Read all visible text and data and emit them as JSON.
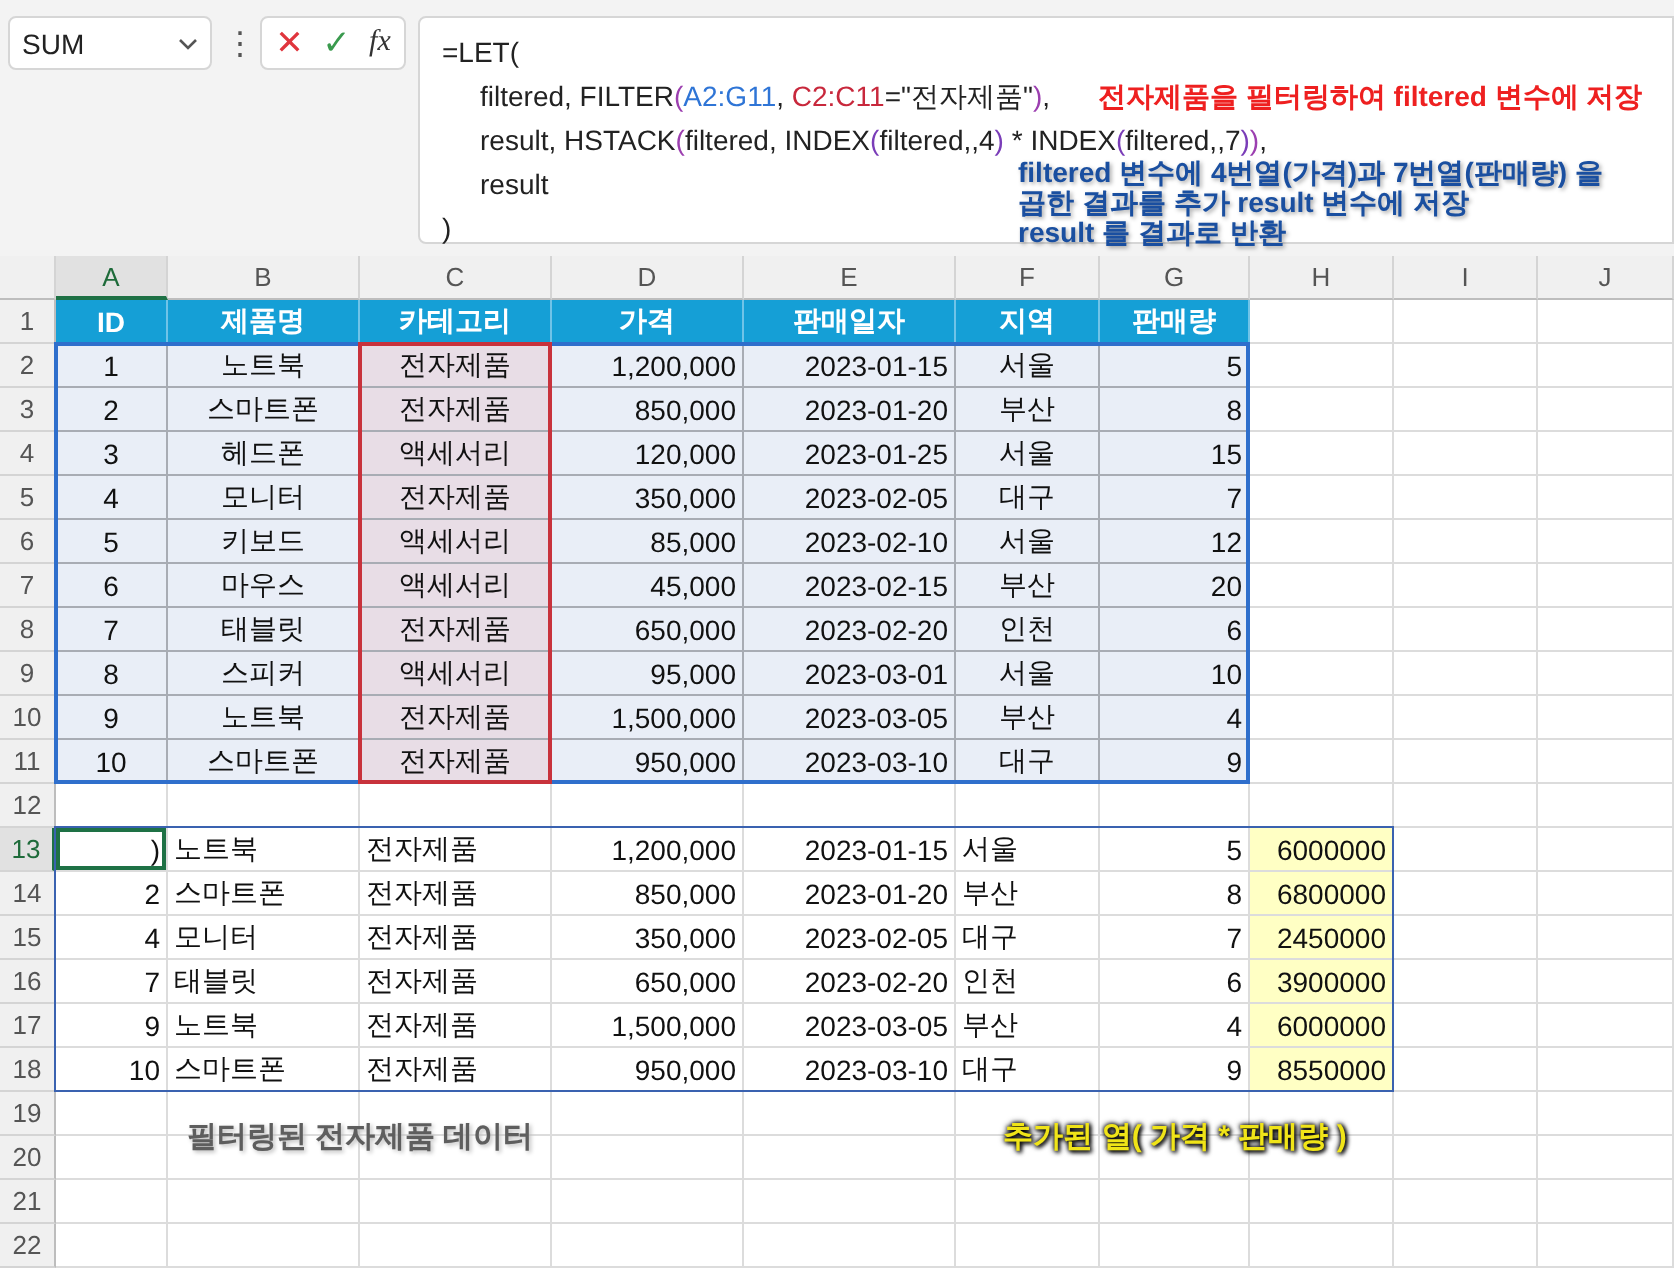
{
  "name_box": {
    "value": "SUM"
  },
  "formula_bar": {
    "menu_glyph": "⋮",
    "cancel_glyph": "✕",
    "enter_glyph": "✓",
    "function_glyph": "fx"
  },
  "formula": {
    "lines": [
      [
        {
          "text": "=LET("
        }
      ],
      [
        {
          "text": "filtered, FILTER"
        },
        {
          "text": "(",
          "color": "#9c3fb0"
        },
        {
          "text": "A2:G11",
          "color": "#2f75d6"
        },
        {
          "text": ", "
        },
        {
          "text": "C2:C11",
          "color": "#c8283c"
        },
        {
          "text": "=\"전자제품\""
        },
        {
          "text": ")",
          "color": "#9c3fb0"
        },
        {
          "text": ","
        }
      ],
      [
        {
          "text": "result, HSTACK"
        },
        {
          "text": "(",
          "color": "#9c3fb0"
        },
        {
          "text": "filtered, INDEX"
        },
        {
          "text": "(",
          "color": "#7a3db8"
        },
        {
          "text": "filtered,,4"
        },
        {
          "text": ")",
          "color": "#7a3db8"
        },
        {
          "text": " * INDEX"
        },
        {
          "text": "(",
          "color": "#7a3db8"
        },
        {
          "text": "filtered,,7"
        },
        {
          "text": ")",
          "color": "#7a3db8"
        },
        {
          "text": ")",
          "color": "#9c3fb0"
        },
        {
          "text": ","
        }
      ],
      [
        {
          "text": "result"
        }
      ],
      [
        {
          "text": ")"
        }
      ]
    ]
  },
  "notes": [
    {
      "kind": "red",
      "lines": [
        "전자제품을 필터링하여 filtered 변수에 저장"
      ]
    },
    {
      "kind": "blue",
      "lines": [
        "filtered 변수에 4번열(가격)과 7번열(판매량) 을",
        "곱한 결과를 추가 result 변수에 저장",
        "result 를 결과로 반환"
      ]
    },
    {
      "kind": "grey",
      "lines": [
        "필터링된 전자제품 데이터"
      ]
    },
    {
      "kind": "yellow",
      "lines": [
        "추가된 열( 가격 * 판매량 )"
      ]
    }
  ],
  "columns": [
    {
      "label": "A",
      "selected": true
    },
    {
      "label": "B",
      "selected": false
    },
    {
      "label": "C",
      "selected": false
    },
    {
      "label": "D",
      "selected": false
    },
    {
      "label": "E",
      "selected": false
    },
    {
      "label": "F",
      "selected": false
    },
    {
      "label": "G",
      "selected": false
    },
    {
      "label": "H",
      "selected": false
    },
    {
      "label": "I",
      "selected": false
    },
    {
      "label": "J",
      "selected": false
    }
  ],
  "row_numbers": [
    {
      "label": "1",
      "selected": false
    },
    {
      "label": "2",
      "selected": false
    },
    {
      "label": "3",
      "selected": false
    },
    {
      "label": "4",
      "selected": false
    },
    {
      "label": "5",
      "selected": false
    },
    {
      "label": "6",
      "selected": false
    },
    {
      "label": "7",
      "selected": false
    },
    {
      "label": "8",
      "selected": false
    },
    {
      "label": "9",
      "selected": false
    },
    {
      "label": "10",
      "selected": false
    },
    {
      "label": "11",
      "selected": false
    },
    {
      "label": "12",
      "selected": false
    },
    {
      "label": "13",
      "selected": true
    },
    {
      "label": "14",
      "selected": false
    },
    {
      "label": "15",
      "selected": false
    },
    {
      "label": "16",
      "selected": false
    },
    {
      "label": "17",
      "selected": false
    },
    {
      "label": "18",
      "selected": false
    },
    {
      "label": "19",
      "selected": false
    },
    {
      "label": "20",
      "selected": false
    },
    {
      "label": "21",
      "selected": false
    },
    {
      "label": "22",
      "selected": false
    }
  ],
  "source_table": {
    "headers": [
      "ID",
      "제품명",
      "카테고리",
      "가격",
      "판매일자",
      "지역",
      "판매량"
    ],
    "rows": [
      [
        "1",
        "노트북",
        "전자제품",
        "1,200,000",
        "2023-01-15",
        "서울",
        "5"
      ],
      [
        "2",
        "스마트폰",
        "전자제품",
        "850,000",
        "2023-01-20",
        "부산",
        "8"
      ],
      [
        "3",
        "헤드폰",
        "액세서리",
        "120,000",
        "2023-01-25",
        "서울",
        "15"
      ],
      [
        "4",
        "모니터",
        "전자제품",
        "350,000",
        "2023-02-05",
        "대구",
        "7"
      ],
      [
        "5",
        "키보드",
        "액세서리",
        "85,000",
        "2023-02-10",
        "서울",
        "12"
      ],
      [
        "6",
        "마우스",
        "액세서리",
        "45,000",
        "2023-02-15",
        "부산",
        "20"
      ],
      [
        "7",
        "태블릿",
        "전자제품",
        "650,000",
        "2023-02-20",
        "인천",
        "6"
      ],
      [
        "8",
        "스피커",
        "액세서리",
        "95,000",
        "2023-03-01",
        "서울",
        "10"
      ],
      [
        "9",
        "노트북",
        "전자제품",
        "1,500,000",
        "2023-03-05",
        "부산",
        "4"
      ],
      [
        "10",
        "스마트폰",
        "전자제품",
        "950,000",
        "2023-03-10",
        "대구",
        "9"
      ]
    ]
  },
  "result_rows": [
    {
      "active": true,
      "cells": [
        ")",
        "노트북",
        "전자제품",
        "1,200,000",
        "2023-01-15",
        "서울",
        "5",
        "6000000"
      ]
    },
    {
      "active": false,
      "cells": [
        "2",
        "스마트폰",
        "전자제품",
        "850,000",
        "2023-01-20",
        "부산",
        "8",
        "6800000"
      ]
    },
    {
      "active": false,
      "cells": [
        "4",
        "모니터",
        "전자제품",
        "350,000",
        "2023-02-05",
        "대구",
        "7",
        "2450000"
      ]
    },
    {
      "active": false,
      "cells": [
        "7",
        "태블릿",
        "전자제품",
        "650,000",
        "2023-02-20",
        "인천",
        "6",
        "3900000"
      ]
    },
    {
      "active": false,
      "cells": [
        "9",
        "노트북",
        "전자제품",
        "1,500,000",
        "2023-03-05",
        "부산",
        "4",
        "6000000"
      ]
    },
    {
      "active": false,
      "cells": [
        "10",
        "스마트폰",
        "전자제품",
        "950,000",
        "2023-03-10",
        "대구",
        "9",
        "8550000"
      ]
    }
  ]
}
